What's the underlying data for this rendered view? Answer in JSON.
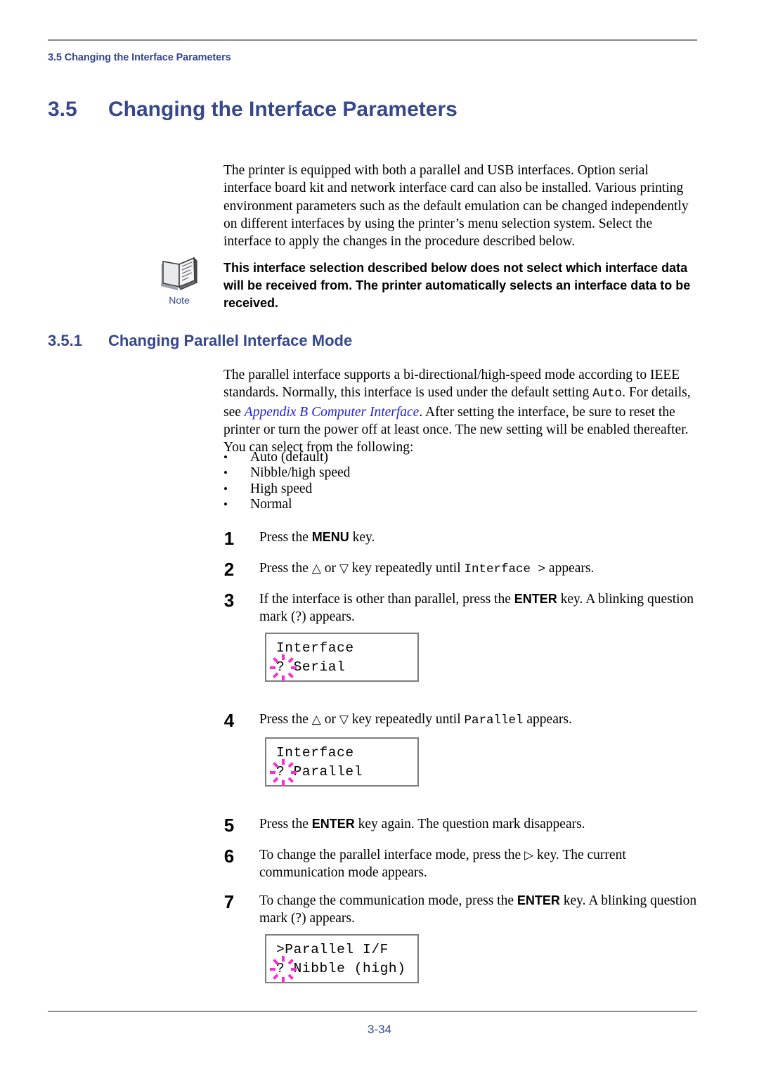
{
  "header": {
    "running_header": "3.5 Changing the Interface Parameters"
  },
  "section": {
    "number": "3.5",
    "title": "Changing the Interface Parameters"
  },
  "intro": {
    "text": "The printer is equipped with both a parallel and USB interfaces. Option serial interface board kit and network interface card can also be installed. Various printing environment parameters such as the default emulation can be changed independently on different interfaces by using the printer’s menu selection system. Select the interface to apply the changes in the procedure described below."
  },
  "note": {
    "icon": "note-book-icon",
    "label": "Note",
    "text": "This interface selection described below does not select which interface data will be received from. The printer automatically selects an interface data to be received."
  },
  "subsection": {
    "number": "3.5.1",
    "title": "Changing Parallel Interface Mode",
    "paragraph_part1": "The parallel interface supports a bi-directional/high-speed mode according to IEEE standards. Normally, this interface is used under the default setting ",
    "paragraph_mono1": "Auto",
    "paragraph_part2": ". For details, see ",
    "paragraph_link": "Appendix B Computer Interface",
    "paragraph_part3": ". After setting the interface, be sure to reset the printer or turn the power off at least once. The new setting will be enabled thereafter. You can select from the following:"
  },
  "bullets": {
    "mark": "•",
    "items": [
      "Auto (default)",
      "Nibble/high speed",
      "High speed",
      "Normal"
    ]
  },
  "steps": [
    {
      "number": "1",
      "pre": "Press the ",
      "key": "MENU",
      "post": " key."
    },
    {
      "number": "2",
      "pre": "Press the ",
      "up_arrow": "△",
      "mid": " or ",
      "down_arrow": "▽",
      "post": " key repeatedly until ",
      "mono": "Interface >",
      "tail": " appears."
    },
    {
      "number": "3",
      "pre": "If the interface is other than parallel, press the ",
      "key": "ENTER",
      "post": " key. A blinking question mark (?) appears."
    },
    {
      "number": "4",
      "pre": "Press the ",
      "up_arrow": "△",
      "mid": " or ",
      "down_arrow": "▽",
      "post": " key repeatedly until ",
      "mono": "Parallel",
      "tail": " appears."
    },
    {
      "number": "5",
      "pre": "Press the ",
      "key": "ENTER",
      "post": " key again. The question mark disappears."
    },
    {
      "number": "6",
      "pre": "To change the parallel interface mode, press the ",
      "right_arrow": "▷",
      "post": " key. The current communication mode appears."
    },
    {
      "number": "7",
      "pre": "To change the communication mode, press the ",
      "key": "ENTER",
      "post": " key. A blinking question mark (?) appears."
    }
  ],
  "displays": [
    {
      "line1": "Interface",
      "line2": "? Serial",
      "blink": true
    },
    {
      "line1": "Interface",
      "line2": "? Parallel",
      "blink": true
    },
    {
      "line1": ">Parallel I/F",
      "line2": "? Nibble (high)",
      "blink": true
    }
  ],
  "colors": {
    "heading_blue": "#36478c",
    "link_blue": "#2222dd",
    "blink_magenta": "#ff2ad4",
    "rule_gray": "#8a8a8a",
    "lcd_border": "#7d7d7d"
  },
  "footer": {
    "page_number": "3-34"
  }
}
